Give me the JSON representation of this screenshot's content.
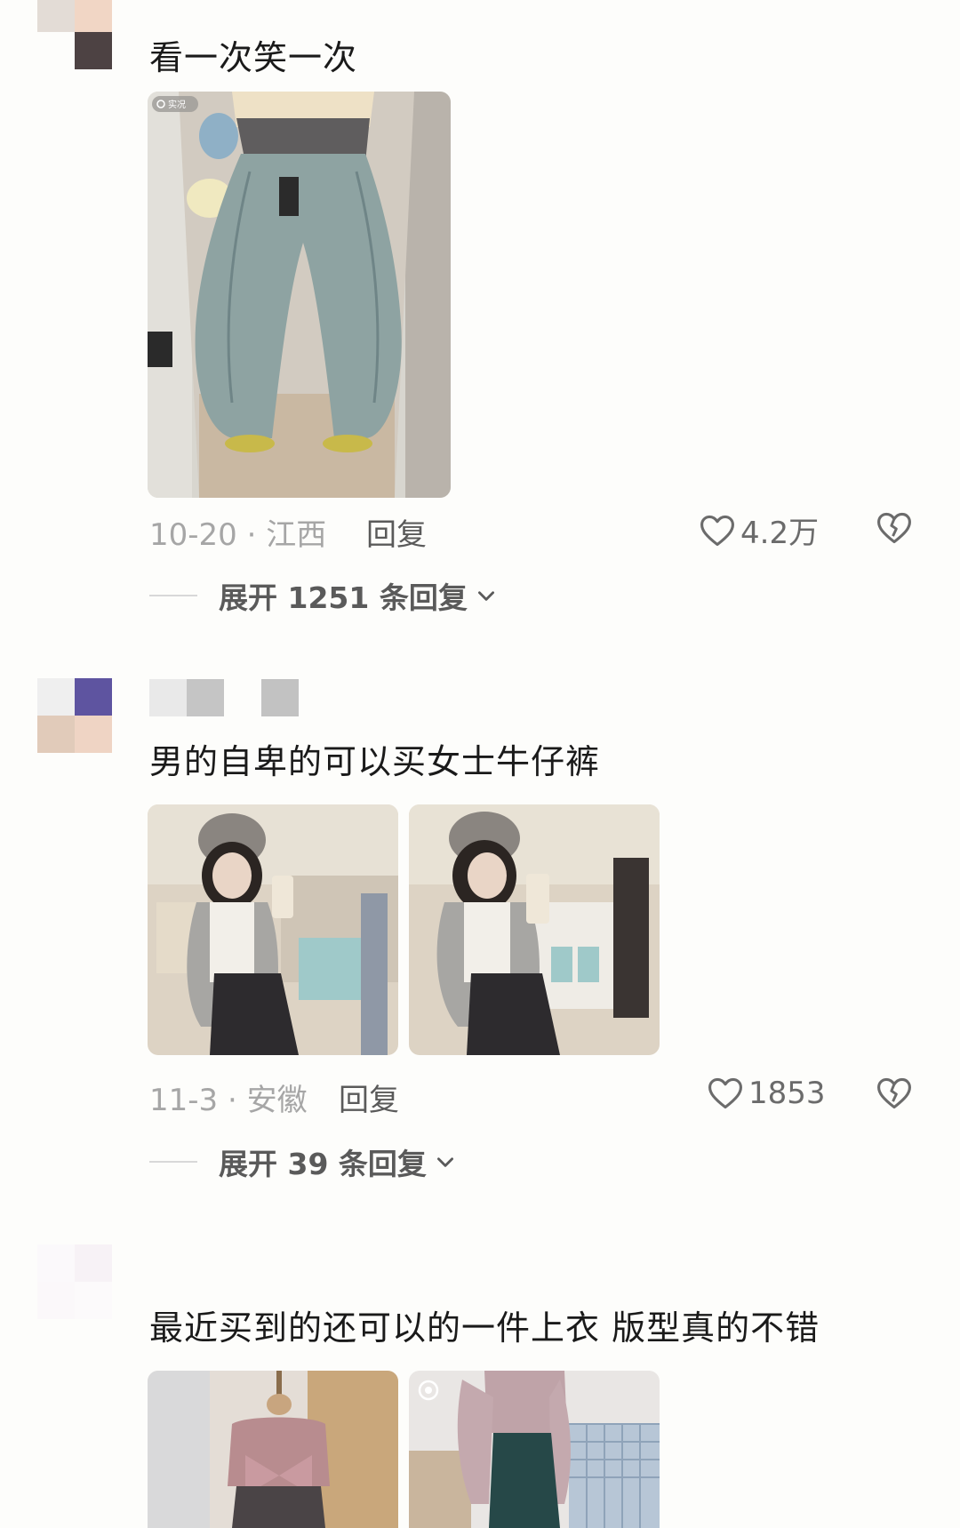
{
  "colors": {
    "background": "#fdfdfb",
    "meta_text": "#a6a6a6",
    "action_text": "#5a5a5a"
  },
  "comments": [
    {
      "text": "看一次笑一次",
      "photo_badge": "实况",
      "meta": "10-20 · 江西",
      "reply_label": "回复",
      "likes": "4.2万",
      "expand_label": "展开 1251 条回复"
    },
    {
      "text": "男的自卑的可以买女士牛仔裤",
      "meta": "11-3 · 安徽",
      "reply_label": "回复",
      "likes": "1853",
      "expand_label": "展开 39 条回复"
    },
    {
      "text": "最近买到的还可以的一件上衣 版型真的不错"
    }
  ],
  "icons": {
    "like": "heart-outline-icon",
    "dislike": "broken-heart-icon",
    "expand": "chevron-down-icon",
    "live_photo": "live-photo-icon"
  }
}
